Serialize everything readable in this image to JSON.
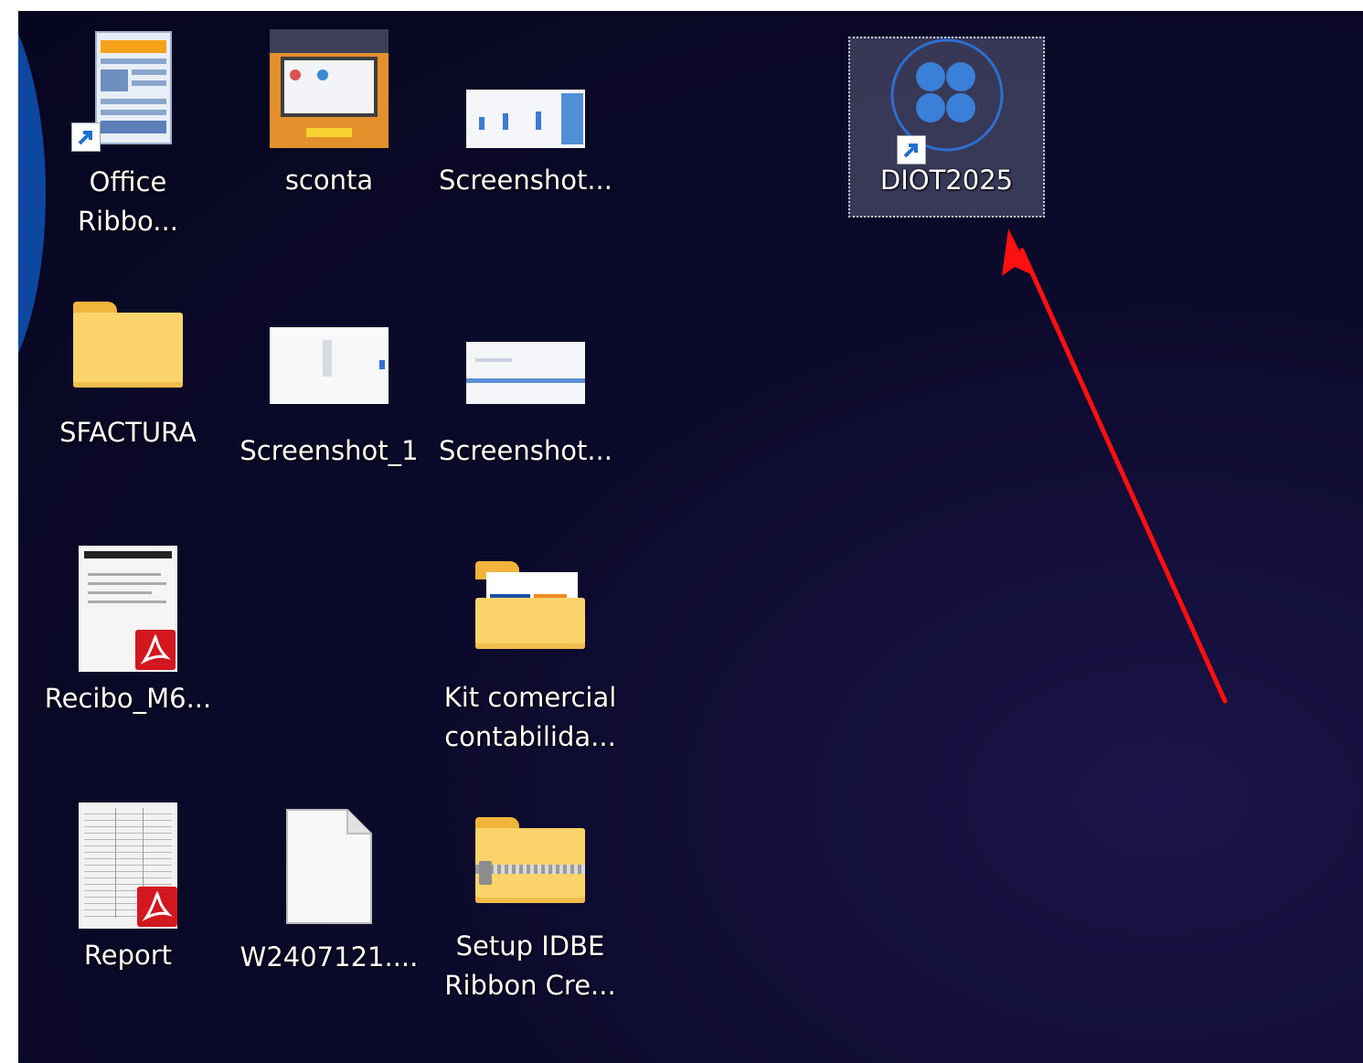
{
  "desktop": {
    "icons": [
      {
        "label_lines": [
          "Office",
          "Ribbo..."
        ],
        "icon": "document-shortcut-icon"
      },
      {
        "label_lines": [
          "sconta"
        ],
        "icon": "image-thumbnail-icon"
      },
      {
        "label_lines": [
          "Screenshot..."
        ],
        "icon": "image-thumbnail-icon"
      },
      {
        "label_lines": [
          "DIOT2025"
        ],
        "icon": "app-shortcut-icon",
        "selected": true
      },
      {
        "label_lines": [
          "SFACTURA"
        ],
        "icon": "folder-icon"
      },
      {
        "label_lines": [
          "Screenshot_1"
        ],
        "icon": "image-thumbnail-icon"
      },
      {
        "label_lines": [
          "Screenshot..."
        ],
        "icon": "image-thumbnail-icon"
      },
      {
        "label_lines": [
          "Recibo_M6..."
        ],
        "icon": "pdf-file-icon"
      },
      {
        "label_lines": [
          "Kit comercial",
          "contabilida..."
        ],
        "icon": "folder-icon"
      },
      {
        "label_lines": [
          "Report"
        ],
        "icon": "pdf-file-icon"
      },
      {
        "label_lines": [
          "W2407121...."
        ],
        "icon": "blank-file-icon"
      },
      {
        "label_lines": [
          "Setup IDBE",
          "Ribbon Cre..."
        ],
        "icon": "zip-folder-icon"
      }
    ],
    "annotation": {
      "type": "arrow",
      "color": "#ff0000",
      "points_to": "DIOT2025"
    }
  },
  "colors": {
    "background": "#0c0a2c",
    "edge_arc": "#0e47a0",
    "folder": "#fbd36b",
    "pdf_badge": "#d3171f",
    "arrow": "#ff0000"
  }
}
